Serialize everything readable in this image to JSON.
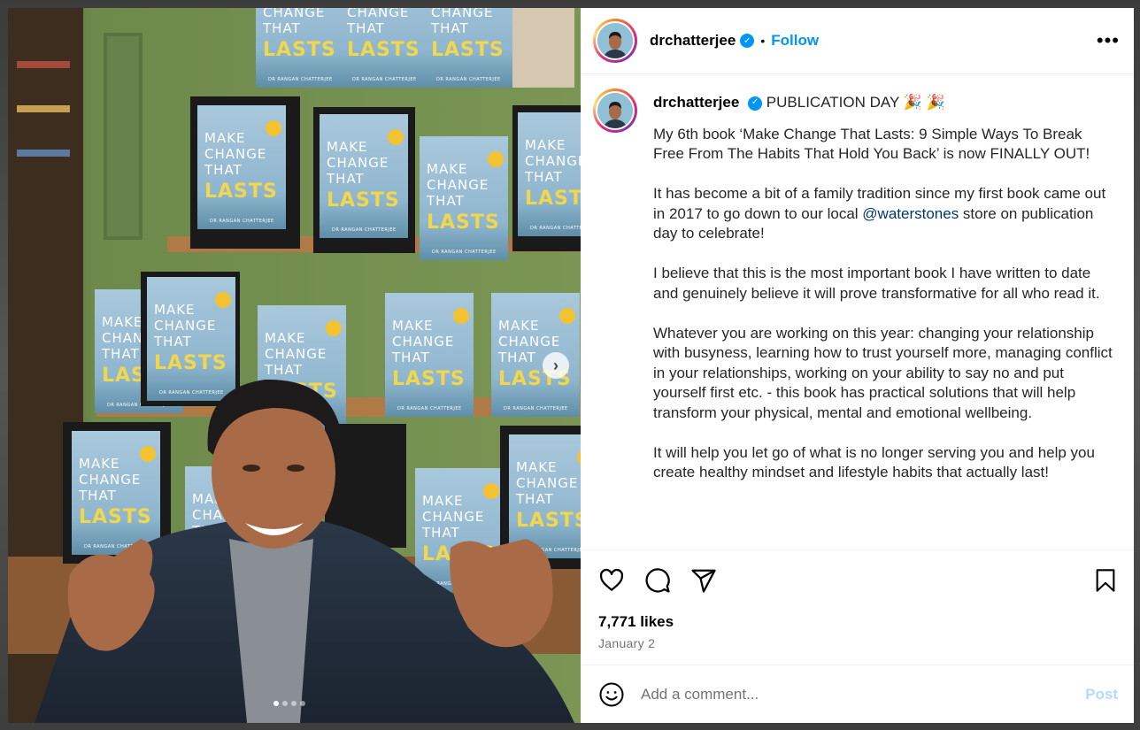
{
  "post": {
    "username": "drchatterjee",
    "follow_label": "Follow",
    "separator": "•",
    "more_label": "•••",
    "caption": {
      "username": "drchatterjee",
      "headline": "PUBLICATION DAY 🎉 🎉",
      "paragraph1": "My 6th book ‘Make Change That Lasts: 9 Simple Ways To Break Free From The Habits That Hold You Back’ is now FINALLY OUT!",
      "paragraph2_before": "It has become a bit of a family tradition since my first book came out in 2017 to go down to our local ",
      "paragraph2_mention": "@waterstones",
      "paragraph2_after": " store on publication day to celebrate!",
      "paragraph3": "I believe that this is the most important book I have written to date and genuinely believe it will prove transformative for all who read it.",
      "paragraph4": "Whatever you are working on this year: changing your relationship with busyness, learning how to trust yourself more, managing conflict in your relationships, working on your ability to say no and put yourself first etc. - this book has practical solutions that will help transform your physical, mental and emotional wellbeing.",
      "paragraph5": "It will help you let go of what is no longer serving you and help you create healthy mindset and lifestyle habits that actually last!"
    },
    "likes": "7,771 likes",
    "date": "January 2",
    "comment_placeholder": "Add a comment...",
    "post_label": "Post"
  },
  "media": {
    "book_line1": "MAKE",
    "book_line2": "CHANGE",
    "book_line3": "THAT",
    "book_line4": "LASTS",
    "book_author": "DR RANGAN CHATTERJEE",
    "carousel_dots": 4,
    "carousel_active": 1
  },
  "colors": {
    "accent": "#0095f6",
    "mention": "#00376b",
    "post_disabled": "#b3dbff",
    "book_cover": "#8fb6cf",
    "book_lasts": "#f2d64b"
  },
  "icons": {
    "verified": "verified-badge-icon",
    "like": "heart-icon",
    "comment": "comment-bubble-icon",
    "share": "paper-plane-icon",
    "save": "bookmark-icon",
    "emoji": "smiley-icon",
    "next": "chevron-right-icon",
    "more": "more-options-icon"
  }
}
